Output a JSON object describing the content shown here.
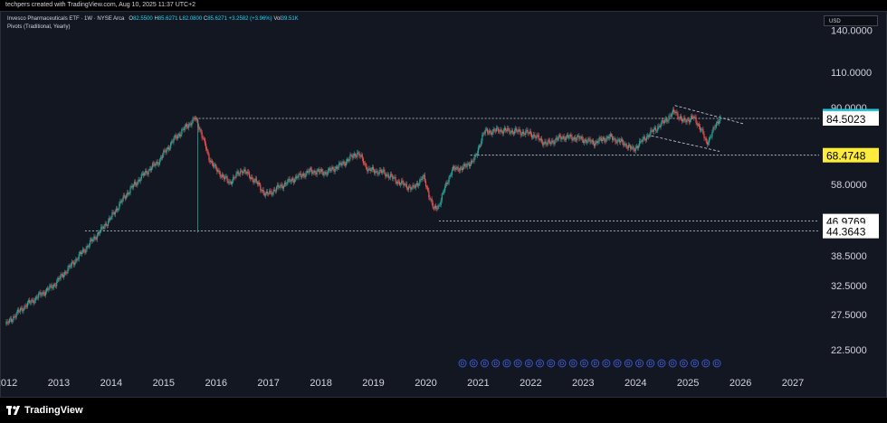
{
  "topbar": {
    "text": "techpers created with TradingView.com, Aug 10, 2025 11:37 UTC+2"
  },
  "legend": {
    "symbol": "Invesco Pharmaceuticals ETF · 1W · NYSE Arca",
    "o_label": "O",
    "o_value": "82.5500",
    "h_label": "H",
    "h_value": "85.6271",
    "l_label": "L",
    "l_value": "82.0800",
    "c_label": "C",
    "c_value": "85.6271",
    "change": "+3.2582 (+3.96%)",
    "vol_label": "Vol",
    "vol_value": "39.51K",
    "indicator": "Pivots (Traditional, Yearly)"
  },
  "currency_button": "USD",
  "footer": {
    "brand": "TradingView"
  },
  "colors": {
    "bg": "#131722",
    "up": "#26a69a",
    "down": "#ef5350",
    "text": "#d1d4dc",
    "price_tag": "#26c6da",
    "pivot_tag": "#ffeb3b"
  },
  "chart_data": {
    "type": "line",
    "y_scale": "log",
    "ylim": [
      20.5,
      150
    ],
    "y_tick_labels": [
      {
        "label": "22.5000",
        "value": 22.5
      },
      {
        "label": "27.5000",
        "value": 27.5
      },
      {
        "label": "32.5000",
        "value": 32.5
      },
      {
        "label": "38.5000",
        "value": 38.5
      },
      {
        "label": "58.0000",
        "value": 58.0
      },
      {
        "label": "90.0000",
        "value": 90.0
      },
      {
        "label": "110.0000",
        "value": 110.0
      },
      {
        "label": "140.0000",
        "value": 140.0
      }
    ],
    "x_tick_labels": [
      {
        "label": "2012",
        "value": 2012.0
      },
      {
        "label": "2013",
        "value": 2013.0
      },
      {
        "label": "2014",
        "value": 2014.0
      },
      {
        "label": "2015",
        "value": 2015.0
      },
      {
        "label": "2016",
        "value": 2016.0
      },
      {
        "label": "2017",
        "value": 2017.0
      },
      {
        "label": "2018",
        "value": 2018.0
      },
      {
        "label": "2019",
        "value": 2019.0
      },
      {
        "label": "2020",
        "value": 2020.0
      },
      {
        "label": "2021",
        "value": 2021.0
      },
      {
        "label": "2022",
        "value": 2022.0
      },
      {
        "label": "2023",
        "value": 2023.0
      },
      {
        "label": "2024",
        "value": 2024.0
      },
      {
        "label": "2025",
        "value": 2025.0
      },
      {
        "label": "2026",
        "value": 2026.0
      },
      {
        "label": "2027",
        "value": 2027.0
      }
    ],
    "xlim": [
      2012.0,
      2027.5
    ],
    "price_points": [
      [
        2012.0,
        26.0
      ],
      [
        2012.3,
        28.5
      ],
      [
        2012.6,
        30.5
      ],
      [
        2012.9,
        32.5
      ],
      [
        2013.2,
        36.0
      ],
      [
        2013.5,
        40.0
      ],
      [
        2013.8,
        44.5
      ],
      [
        2014.0,
        48.0
      ],
      [
        2014.3,
        55.0
      ],
      [
        2014.6,
        61.0
      ],
      [
        2014.9,
        66.0
      ],
      [
        2015.2,
        75.0
      ],
      [
        2015.45,
        81.0
      ],
      [
        2015.6,
        84.5
      ],
      [
        2015.7,
        79.0
      ],
      [
        2015.85,
        68.0
      ],
      [
        2016.0,
        63.0
      ],
      [
        2016.25,
        58.5
      ],
      [
        2016.5,
        63.0
      ],
      [
        2016.75,
        59.0
      ],
      [
        2016.95,
        54.5
      ],
      [
        2017.2,
        57.0
      ],
      [
        2017.5,
        60.0
      ],
      [
        2017.8,
        62.5
      ],
      [
        2018.1,
        62.0
      ],
      [
        2018.4,
        65.0
      ],
      [
        2018.7,
        69.5
      ],
      [
        2018.9,
        63.0
      ],
      [
        2019.2,
        62.0
      ],
      [
        2019.5,
        58.5
      ],
      [
        2019.75,
        56.5
      ],
      [
        2019.95,
        60.5
      ],
      [
        2020.15,
        50.0
      ],
      [
        2020.25,
        51.5
      ],
      [
        2020.5,
        63.0
      ],
      [
        2020.75,
        64.0
      ],
      [
        2020.95,
        67.5
      ],
      [
        2021.1,
        78.0
      ],
      [
        2021.4,
        79.0
      ],
      [
        2021.7,
        78.5
      ],
      [
        2022.0,
        77.5
      ],
      [
        2022.3,
        73.0
      ],
      [
        2022.6,
        76.0
      ],
      [
        2022.9,
        75.5
      ],
      [
        2023.2,
        73.5
      ],
      [
        2023.5,
        76.0
      ],
      [
        2023.8,
        73.0
      ],
      [
        2023.95,
        70.5
      ],
      [
        2024.2,
        76.0
      ],
      [
        2024.5,
        82.0
      ],
      [
        2024.75,
        88.0
      ],
      [
        2024.9,
        83.0
      ],
      [
        2025.1,
        85.0
      ],
      [
        2025.25,
        79.5
      ],
      [
        2025.35,
        73.0
      ],
      [
        2025.55,
        82.0
      ],
      [
        2025.62,
        85.6271
      ]
    ],
    "levels": [
      {
        "label": "85.6271",
        "value": 85.6271,
        "style": "current"
      },
      {
        "label": "84.5023",
        "value": 84.5023,
        "style": "white"
      },
      {
        "label": "68.4748",
        "value": 68.4748,
        "style": "yellow"
      },
      {
        "label": "46.9769",
        "value": 46.9769,
        "style": "white"
      },
      {
        "label": "44.3643",
        "value": 44.3643,
        "style": "white"
      }
    ],
    "horizontal_lines": [
      {
        "value": 84.5023,
        "from": 2015.6
      },
      {
        "value": 68.4748,
        "from": 2020.85
      },
      {
        "value": 46.9769,
        "from": 2020.25
      },
      {
        "value": 44.3643,
        "from": 2013.5
      }
    ],
    "channel_lines": [
      {
        "from": [
          2024.75,
          91.0
        ],
        "to": [
          2026.05,
          82.0
        ]
      },
      {
        "from": [
          2024.3,
          76.5
        ],
        "to": [
          2025.6,
          70.0
        ]
      }
    ],
    "wick_2015": {
      "x": 2015.65,
      "low": 44.0,
      "high": 84.0
    },
    "dividend_markers": {
      "label": "D",
      "count": 24,
      "from": 2020.7,
      "to": 2025.55
    }
  }
}
